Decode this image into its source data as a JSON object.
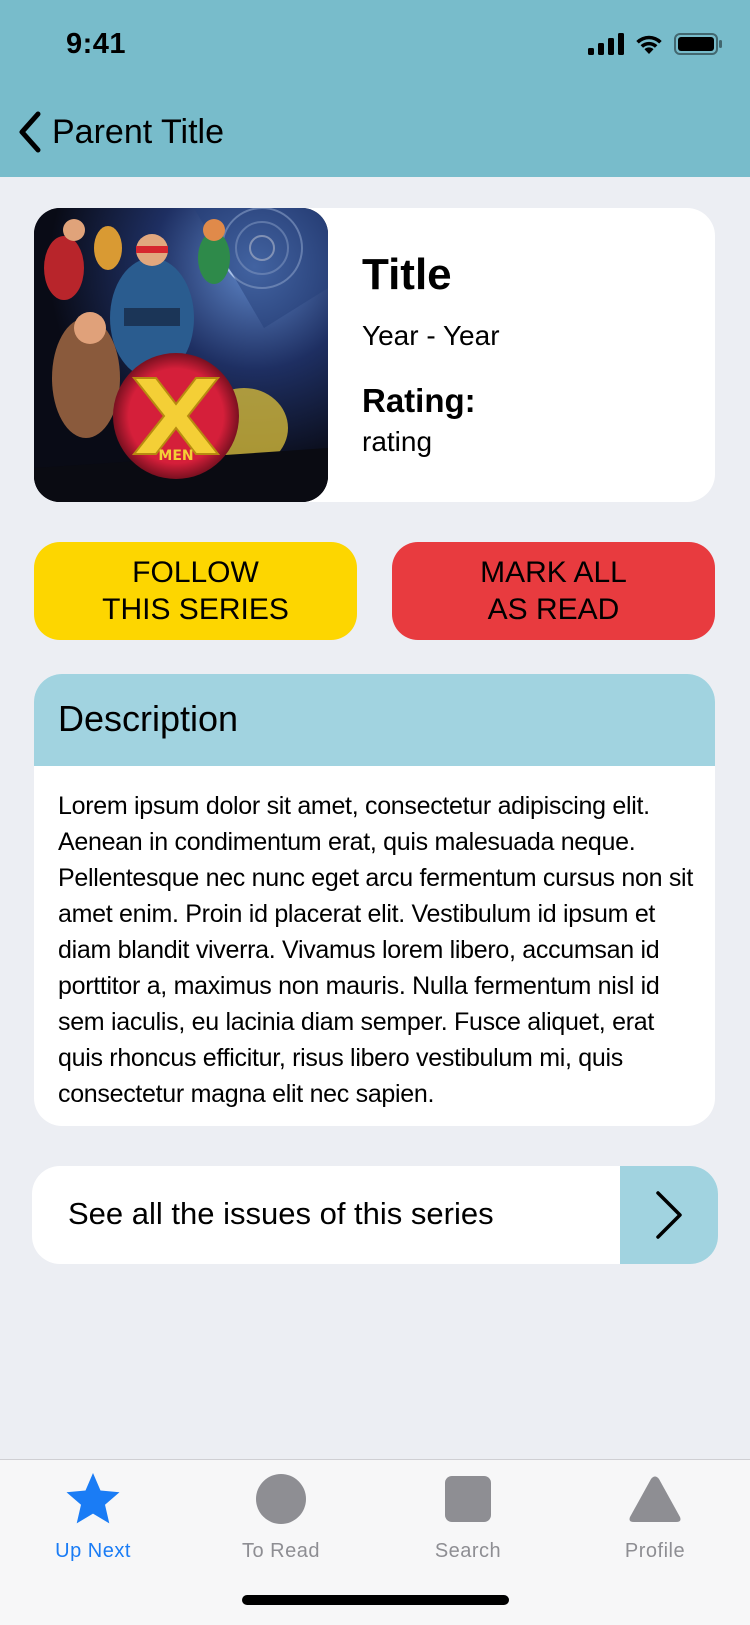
{
  "status_bar": {
    "time": "9:41"
  },
  "nav": {
    "back_label": "Parent Title"
  },
  "series": {
    "title": "Title",
    "years": "Year - Year",
    "rating_label": "Rating:",
    "rating_value": "rating"
  },
  "actions": {
    "follow_label": "FOLLOW\nTHIS SERIES",
    "mark_read_label": "MARK ALL\nAS READ"
  },
  "description": {
    "heading": "Description",
    "body": "Lorem ipsum dolor sit amet, consectetur adipiscing elit. Aenean in condimentum erat, quis malesuada neque. Pellentesque nec nunc eget arcu fermentum cursus non sit amet enim. Proin id placerat elit. Vestibulum id ipsum et diam blandit viverra. Vivamus lorem libero, accumsan id porttitor a, maximus non mauris. Nulla fermentum nisl id sem iaculis, eu lacinia diam semper. Fusce aliquet, erat quis rhoncus efficitur, risus libero vestibulum mi, quis consectetur magna elit nec sapien."
  },
  "issues_link": {
    "label": "See all the issues of this series"
  },
  "cover": {
    "logo_text": "MEN"
  },
  "tab_bar": {
    "tabs": [
      {
        "label": "Up Next",
        "icon": "star-icon",
        "active": true
      },
      {
        "label": "To Read",
        "icon": "circle-icon",
        "active": false
      },
      {
        "label": "Search",
        "icon": "square-icon",
        "active": false
      },
      {
        "label": "Profile",
        "icon": "triangle-icon",
        "active": false
      }
    ]
  },
  "colors": {
    "header": "#78bccb",
    "accent_light": "#a1d3e0",
    "follow": "#fdd600",
    "mark_read": "#e83b3f",
    "tab_active": "#1a7cf5",
    "tab_inactive": "#8e8e93"
  }
}
